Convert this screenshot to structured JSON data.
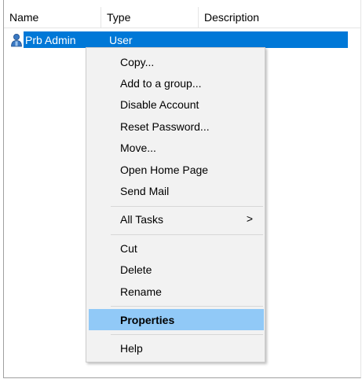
{
  "columns": {
    "name": "Name",
    "type": "Type",
    "description": "Description"
  },
  "row": {
    "name": "Prb Admin",
    "type": "User",
    "icon": "user-icon"
  },
  "menu": {
    "copy": "Copy...",
    "add_to_group": "Add to a group...",
    "disable_account": "Disable Account",
    "reset_password": "Reset Password...",
    "move": "Move...",
    "open_home_page": "Open Home Page",
    "send_mail": "Send Mail",
    "all_tasks": "All Tasks",
    "all_tasks_arrow": ">",
    "cut": "Cut",
    "delete": "Delete",
    "rename": "Rename",
    "properties": "Properties",
    "help": "Help"
  },
  "colors": {
    "selection": "#0078d7",
    "menu_highlight": "#91c9f7",
    "menu_bg": "#f2f2f2"
  }
}
